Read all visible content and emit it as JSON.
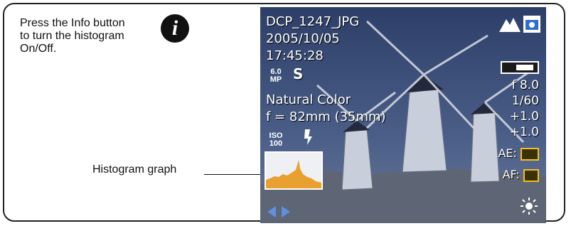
{
  "callout": {
    "line1": "Press the Info button",
    "line2": "to turn the histogram",
    "line3": "On/Off.",
    "icon": "info-icon"
  },
  "histogram_callout": "Histogram graph",
  "screen": {
    "filename": "DCP_1247_JPG",
    "date": "2005/10/05",
    "time": "17:45:28",
    "megapixels": {
      "top": "6.0",
      "bottom": "MP"
    },
    "quality": "S",
    "color_mode": "Natural Color",
    "focal_length": "f = 82mm (35mm)",
    "iso": {
      "top": "ISO",
      "bottom": "100"
    },
    "aperture": "f 8.0",
    "shutter": "1/60",
    "exposure_comp_1": "+1.0",
    "exposure_comp_2": "+1.0",
    "ae_label": "AE:",
    "af_label": "AF:",
    "nav_icons": [
      "nav-left-arrow-icon",
      "nav-right-arrow-icon"
    ],
    "icons": [
      "landscape-mode-icon",
      "camera-mode-icon",
      "battery-icon",
      "flash-off-icon",
      "white-balance-icon"
    ]
  },
  "colors": {
    "nav_arrow": "#5f8fe0",
    "ae_af_border": "#f2c020",
    "histogram_fill": "#e8a030"
  }
}
